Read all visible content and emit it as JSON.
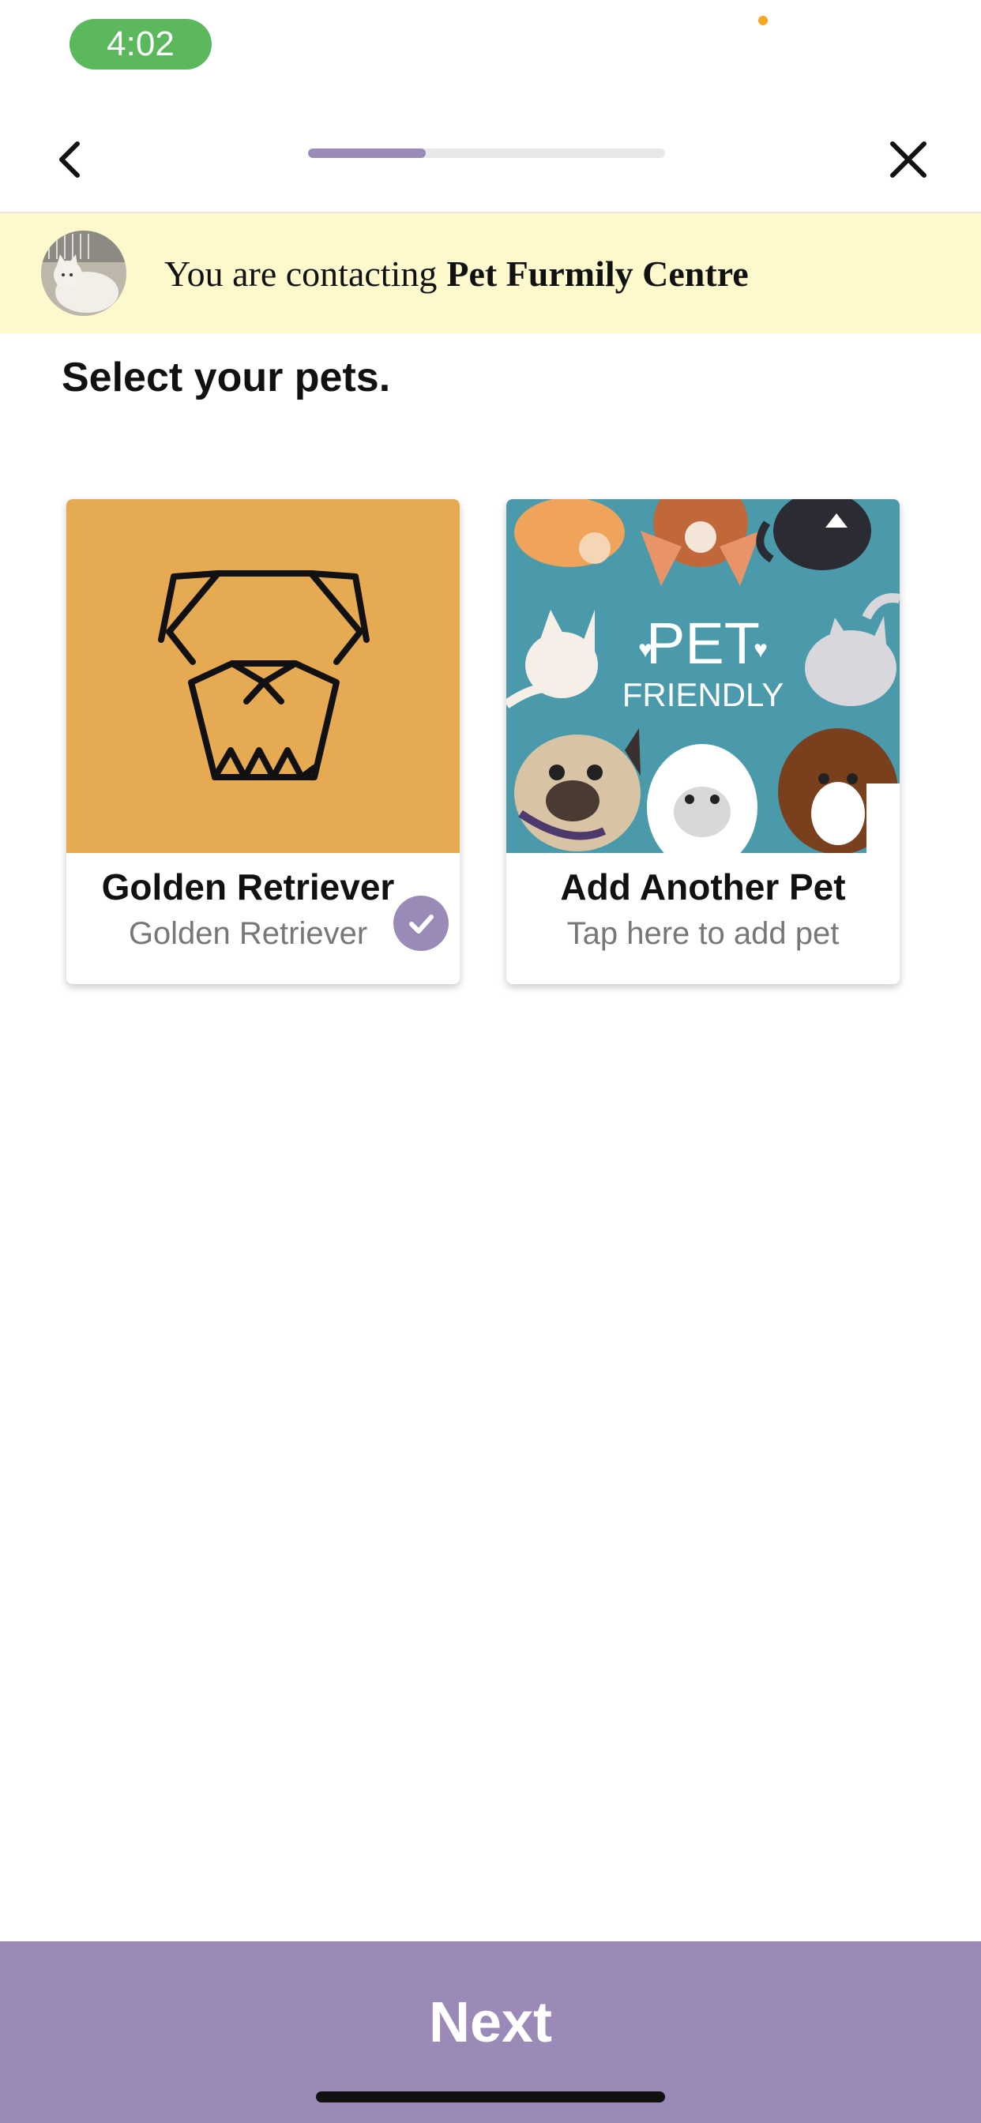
{
  "status_bar": {
    "time": "4:02"
  },
  "nav": {
    "progress_fraction": 0.33
  },
  "banner": {
    "prefix": "You are contacting",
    "business_name": "Pet Furmily Centre"
  },
  "heading": "Select your pets.",
  "pets": [
    {
      "title": "Golden Retriever",
      "subtitle": "Golden Retriever",
      "selected": true
    },
    {
      "title": "Add Another Pet",
      "subtitle": "Tap here to add pet",
      "selected": false
    }
  ],
  "add_pet_image_text": {
    "line1": "PET",
    "line2": "FRIENDLY"
  },
  "next_button": {
    "label": "Next"
  },
  "colors": {
    "accent": "#9b8ab8",
    "banner_bg": "#fdf9cc",
    "dog_card_bg": "#e6ab52",
    "pet_friendly_bg": "#4a9aab",
    "time_pill": "#5cb85c"
  }
}
